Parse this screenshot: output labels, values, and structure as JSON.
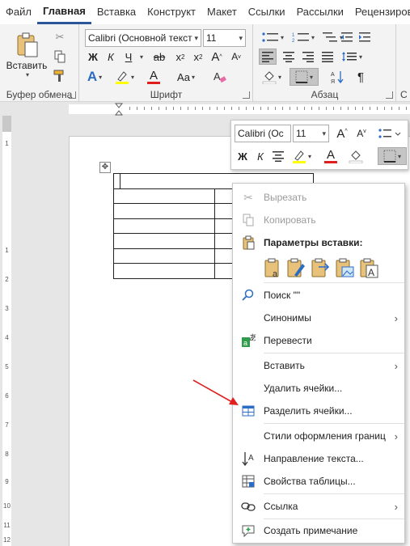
{
  "ribbon_tabs": [
    {
      "label": "Файл",
      "active": false
    },
    {
      "label": "Главная",
      "active": true
    },
    {
      "label": "Вставка",
      "active": false
    },
    {
      "label": "Конструкт",
      "active": false
    },
    {
      "label": "Макет",
      "active": false
    },
    {
      "label": "Ссылки",
      "active": false
    },
    {
      "label": "Рассылки",
      "active": false
    },
    {
      "label": "Рецензиров",
      "active": false
    }
  ],
  "ribbon": {
    "clipboard": {
      "label": "Буфер обмена",
      "paste_label": "Вставить"
    },
    "font": {
      "label": "Шрифт",
      "font_name": "Calibri (Основной текст",
      "font_size": "11",
      "bold": "Ж",
      "italic": "К",
      "underline": "Ч",
      "strike": "ab",
      "subscript": "x",
      "superscript": "x",
      "grow": "A",
      "shrink": "A",
      "case": "Aa",
      "clear": "A",
      "color_letter": "A",
      "highlight_color": "#ffff00",
      "font_color": "#e01e1e"
    },
    "paragraph": {
      "label": "Абзац",
      "pilcrow": "¶"
    },
    "styles": {
      "label": "С"
    }
  },
  "mini_toolbar": {
    "font_name": "Calibri (Ос",
    "font_size": "11",
    "bold": "Ж",
    "italic": "К",
    "font_color_letter": "A"
  },
  "ruler": {
    "v_numbers": [
      "1",
      "1",
      "2",
      "3",
      "4",
      "5",
      "6",
      "7",
      "8",
      "9",
      "10",
      "11",
      "12"
    ]
  },
  "context_menu": {
    "cut": "Вырезать",
    "copy": "Копировать",
    "paste_options": "Параметры вставки:",
    "search": "Поиск \"\"",
    "synonyms": "Синонимы",
    "translate": "Перевести",
    "insert": "Вставить",
    "delete_cells": "Удалить ячейки...",
    "split_cells": "Разделить ячейки...",
    "border_styles": "Стили оформления границ",
    "text_direction": "Направление текста...",
    "table_properties": "Свойства таблицы...",
    "link": "Ссылка",
    "new_comment": "Создать примечание"
  },
  "colors": {
    "accent": "#2b579a",
    "arrow": "#e02020"
  }
}
